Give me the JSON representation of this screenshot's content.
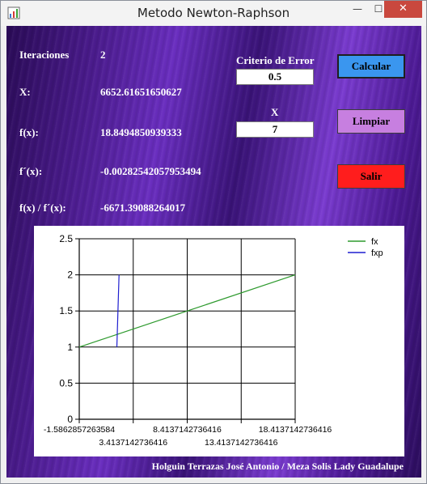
{
  "window": {
    "title": "Metodo Newton-Raphson",
    "minimize_glyph": "—",
    "maximize_glyph": "☐",
    "close_glyph": "✕",
    "app_icon": "chart-app-icon"
  },
  "results": {
    "iterations_label": "Iteraciones",
    "iterations_value": "2",
    "x_label": "X:",
    "x_value": "6652.61651650627",
    "fx_label": "f(x):",
    "fx_value": "18.8494850939333",
    "dfx_label": "f´(x):",
    "dfx_value": "-0.00282542057953494",
    "ratio_label": "f(x) / f´(x):",
    "ratio_value": "-6671.39088264017"
  },
  "inputs": {
    "error_label": "Criterio de Error",
    "error_value": "0.5",
    "x_label": "X",
    "x_value": "7"
  },
  "buttons": {
    "calc": "Calcular",
    "clear": "Limpiar",
    "exit": "Salir"
  },
  "footer": {
    "authors": "Holguin Terrazas José Antonio / Meza Solis Lady Guadalupe"
  },
  "colors": {
    "fx": "#2e9a2e",
    "fxp": "#1f1fd0",
    "calc_button": "#3a96ef",
    "clear_button": "#c77fe0",
    "exit_button": "#ff1d1d"
  },
  "chart_data": {
    "type": "line",
    "xlim": [
      -1.5862857263584,
      18.4137142736416
    ],
    "ylim": [
      0,
      2.5
    ],
    "y_ticks": [
      "0",
      "0.5",
      "1",
      "1.5",
      "2",
      "2.5"
    ],
    "x_ticks": [
      "-1.5862857263584",
      "3.4137142736416",
      "8.4137142736416",
      "13.4137142736416",
      "18.4137142736416"
    ],
    "legend_position": "top-right",
    "series": [
      {
        "name": "fx",
        "x": [
          -1.5862857263584,
          18.4137142736416
        ],
        "y": [
          1,
          2
        ]
      },
      {
        "name": "fxp",
        "x": [
          1.9,
          2.1
        ],
        "y": [
          1,
          2
        ]
      }
    ]
  }
}
